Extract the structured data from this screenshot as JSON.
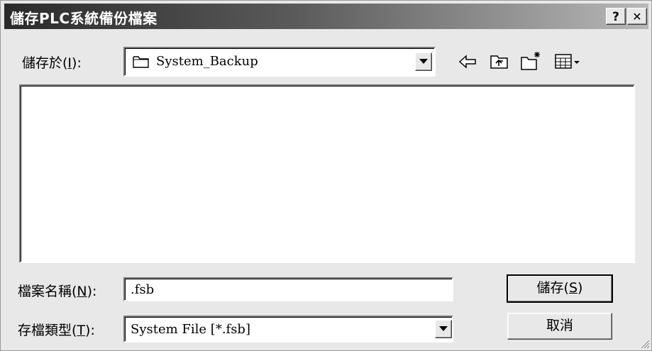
{
  "dialog": {
    "title": "儲存PLC系統備份檔案",
    "help_label": "?",
    "close_label": "✕"
  },
  "save_in": {
    "label_pre": "儲存於(",
    "label_key": "I",
    "label_post": "):",
    "value": "System_Backup"
  },
  "filename": {
    "label_pre": "檔案名稱(",
    "label_key": "N",
    "label_post": "):",
    "value": ".fsb"
  },
  "filetype": {
    "label_pre": "存檔類型(",
    "label_key": "T",
    "label_post": "):",
    "value": "System File [*.fsb]"
  },
  "buttons": {
    "save_pre": "儲存(",
    "save_key": "S",
    "save_post": ")",
    "cancel": "取消"
  },
  "toolbar": {
    "icons": [
      "back-arrow-icon",
      "up-folder-icon",
      "new-folder-icon",
      "view-menu-icon"
    ]
  },
  "colors": {
    "title_start": "#2a2a2a",
    "title_end": "#b8b8b8",
    "face": "#e8e8e8"
  }
}
